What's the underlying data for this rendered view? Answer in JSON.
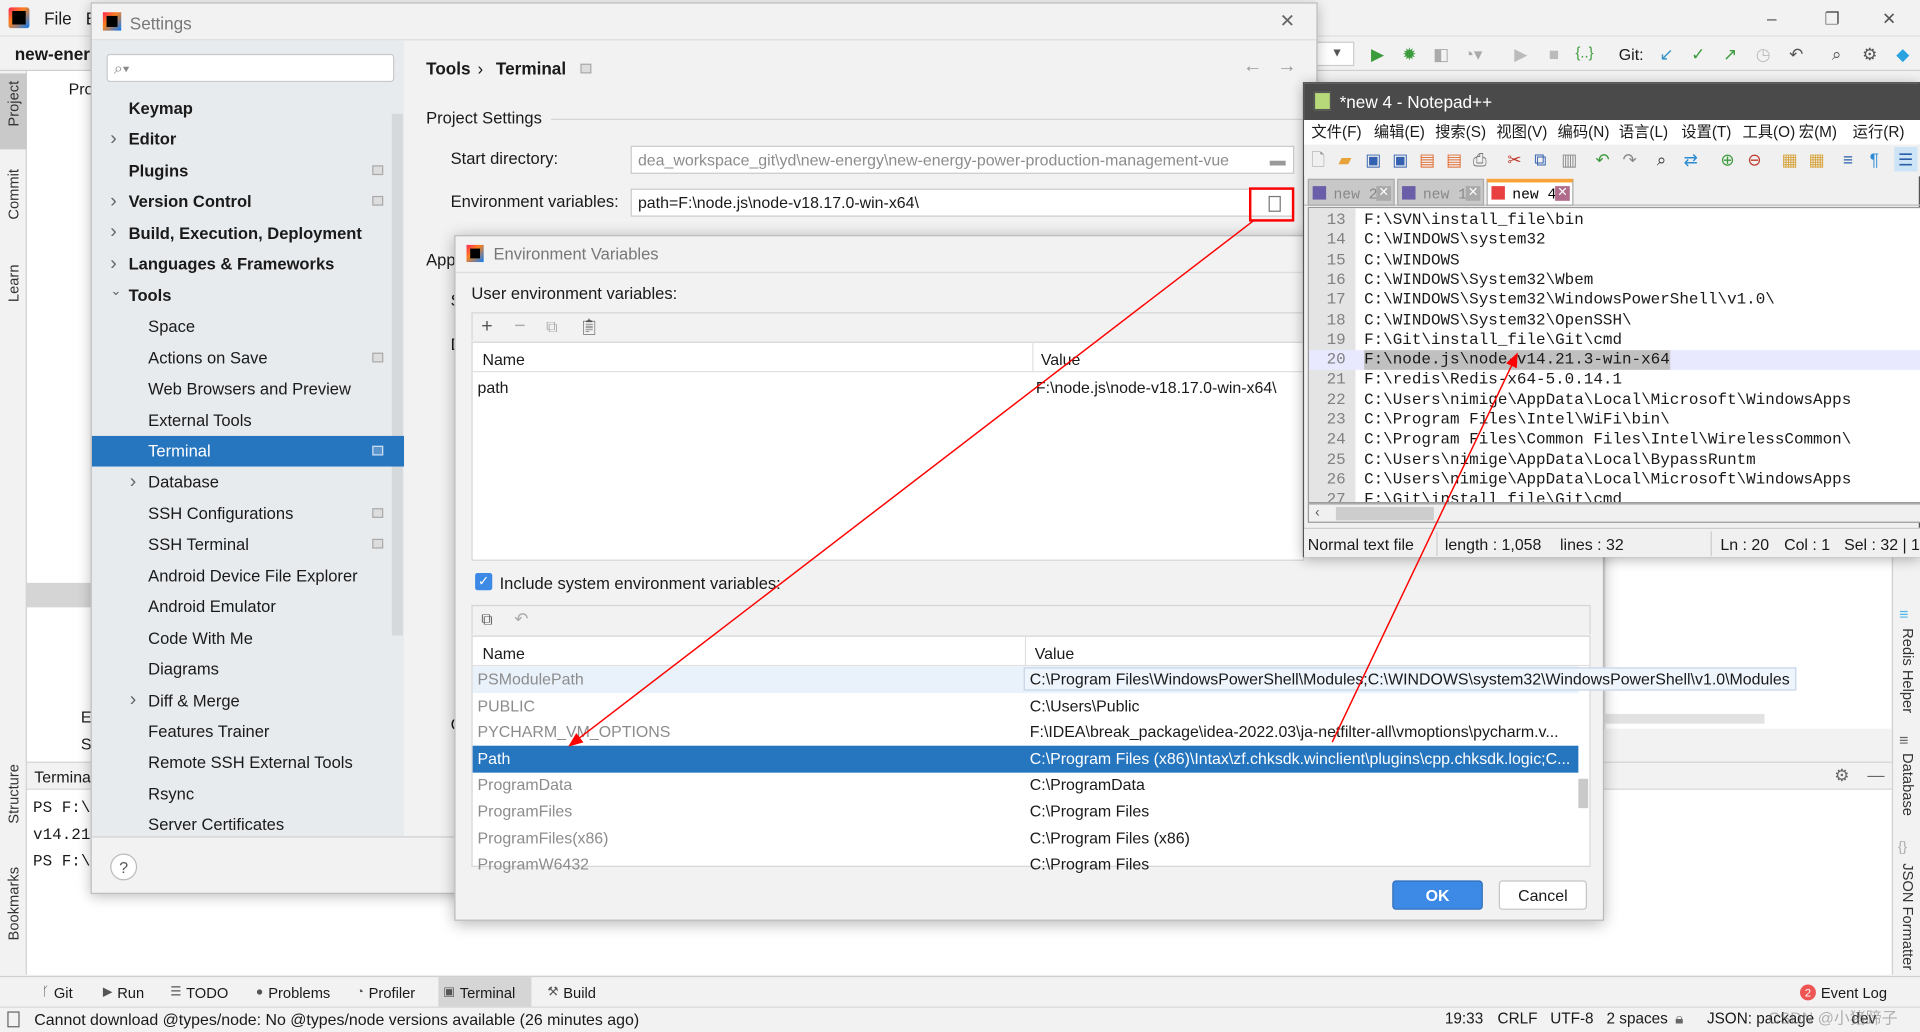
{
  "ide": {
    "menu": {
      "file": "File",
      "edit_partial": "E"
    },
    "project_name": "new-energ",
    "toolbar": {
      "git_label": "Git:"
    },
    "window_controls": {
      "minimize": "–",
      "restore": "❐",
      "close": "✕"
    },
    "left_strip": [
      "Project",
      "Commit",
      "Learn",
      "Structure",
      "Bookmarks"
    ],
    "right_strip": [
      "Redis Helper",
      "Database",
      "JSON Formatter"
    ],
    "project_tree": {
      "partial_header": "Pro",
      "items_partial": [
        "E",
        "S"
      ]
    },
    "terminal": {
      "header": "Termina",
      "lines": [
        "PS F:\\",
        "v14.21",
        "PS F:\\"
      ]
    },
    "tool_windows": [
      {
        "label": "Git",
        "icon": "git-branch-icon"
      },
      {
        "label": "Run",
        "icon": "play-icon"
      },
      {
        "label": "TODO",
        "icon": "list-icon"
      },
      {
        "label": "Problems",
        "icon": "warning-icon"
      },
      {
        "label": "Profiler",
        "icon": "profiler-icon"
      },
      {
        "label": "Terminal",
        "icon": "terminal-icon",
        "active": true
      },
      {
        "label": "Build",
        "icon": "hammer-icon"
      }
    ],
    "event_log": {
      "label": "Event Log",
      "count": "2"
    },
    "status_bar": {
      "message": "Cannot download @types/node: No @types/node versions available (26 minutes ago)",
      "time": "19:33",
      "line_sep": "CRLF",
      "encoding": "UTF-8",
      "indent": "2 spaces",
      "schema": "JSON: package",
      "branch": "dev"
    },
    "watermark": "CSDN @小猪蹄子"
  },
  "settings": {
    "title": "Settings",
    "search_placeholder": "",
    "breadcrumb": {
      "parent": "Tools",
      "separator": "›",
      "current": "Terminal"
    },
    "nav": [
      {
        "label": "Keymap",
        "level": 0,
        "bold": true
      },
      {
        "label": "Editor",
        "level": 0,
        "bold": true,
        "arrow": "right"
      },
      {
        "label": "Plugins",
        "level": 0,
        "bold": true,
        "mark": true
      },
      {
        "label": "Version Control",
        "level": 0,
        "bold": true,
        "arrow": "right",
        "mark": true
      },
      {
        "label": "Build, Execution, Deployment",
        "level": 0,
        "bold": true,
        "arrow": "right"
      },
      {
        "label": "Languages & Frameworks",
        "level": 0,
        "bold": true,
        "arrow": "right"
      },
      {
        "label": "Tools",
        "level": 0,
        "bold": true,
        "arrow": "down"
      },
      {
        "label": "Space",
        "level": 1
      },
      {
        "label": "Actions on Save",
        "level": 1,
        "mark": true
      },
      {
        "label": "Web Browsers and Preview",
        "level": 1
      },
      {
        "label": "External Tools",
        "level": 1
      },
      {
        "label": "Terminal",
        "level": 1,
        "selected": true,
        "mark": true
      },
      {
        "label": "Database",
        "level": 1,
        "arrow": "right"
      },
      {
        "label": "SSH Configurations",
        "level": 1,
        "mark": true
      },
      {
        "label": "SSH Terminal",
        "level": 1,
        "mark": true
      },
      {
        "label": "Android Device File Explorer",
        "level": 1
      },
      {
        "label": "Android Emulator",
        "level": 1
      },
      {
        "label": "Code With Me",
        "level": 1
      },
      {
        "label": "Diagrams",
        "level": 1
      },
      {
        "label": "Diff & Merge",
        "level": 1,
        "arrow": "right"
      },
      {
        "label": "Features Trainer",
        "level": 1
      },
      {
        "label": "Remote SSH External Tools",
        "level": 1
      },
      {
        "label": "Rsync",
        "level": 1
      },
      {
        "label": "Server Certificates",
        "level": 1
      }
    ],
    "project_settings_label": "Project Settings",
    "start_directory": {
      "label": "Start directory:",
      "value": "dea_workspace_git\\yd\\new-energy\\new-energy-power-production-management-vue"
    },
    "env_vars": {
      "label": "Environment variables:",
      "value": "path=F:\\node.js\\node-v18.17.0-win-x64\\"
    },
    "partial_labels": [
      "App",
      "S",
      "D",
      "C"
    ],
    "help": "?"
  },
  "env_dialog": {
    "title": "Environment Variables",
    "user_label": "User environment variables:",
    "columns": {
      "name": "Name",
      "value": "Value"
    },
    "user_rows": [
      {
        "name": "path",
        "value": "F:\\node.js\\node-v18.17.0-win-x64\\"
      }
    ],
    "include_system": {
      "label": "Include system environment variables:",
      "checked": true
    },
    "system_rows": [
      {
        "name": "PSModulePath",
        "value": "C:\\Program Files\\WindowsPowerShell\\Modules;C:\\WINDOWS\\system32\\WindowsPowerShell\\v1.0\\Modules",
        "hover": true
      },
      {
        "name": "PUBLIC",
        "value": "C:\\Users\\Public"
      },
      {
        "name": "PYCHARM_VM_OPTIONS",
        "value": "F:\\IDEA\\break_package\\idea-2022.03\\ja-netfilter-all\\vmoptions\\pycharm.v..."
      },
      {
        "name": "Path",
        "value": "C:\\Program Files (x86)\\Intax\\zf.chksdk.winclient\\plugins\\cpp.chksdk.logic;C...",
        "selected": true
      },
      {
        "name": "ProgramData",
        "value": "C:\\ProgramData"
      },
      {
        "name": "ProgramFiles",
        "value": "C:\\Program Files"
      },
      {
        "name": "ProgramFiles(x86)",
        "value": "C:\\Program Files (x86)"
      },
      {
        "name": "ProgramW6432",
        "value": "C:\\Program Files"
      }
    ],
    "ok": "OK",
    "cancel": "Cancel"
  },
  "notepad": {
    "title": "*new 4 - Notepad++",
    "menu": [
      "文件(F)",
      "编辑(E)",
      "搜索(S)",
      "视图(V)",
      "编码(N)",
      "语言(L)",
      "设置(T)",
      "工具(O)",
      "宏(M)",
      "运行(R)"
    ],
    "tabs": [
      {
        "label": "new 2"
      },
      {
        "label": "new 1"
      },
      {
        "label": "new 4",
        "active": true
      }
    ],
    "lines": [
      {
        "n": "13",
        "text": "F:\\SVN\\install_file\\bin"
      },
      {
        "n": "14",
        "text": "C:\\WINDOWS\\system32"
      },
      {
        "n": "15",
        "text": "C:\\WINDOWS"
      },
      {
        "n": "16",
        "text": "C:\\WINDOWS\\System32\\Wbem"
      },
      {
        "n": "17",
        "text": "C:\\WINDOWS\\System32\\WindowsPowerShell\\v1.0\\"
      },
      {
        "n": "18",
        "text": "C:\\WINDOWS\\System32\\OpenSSH\\"
      },
      {
        "n": "19",
        "text": "F:\\Git\\install_file\\Git\\cmd"
      },
      {
        "n": "20",
        "text": "F:\\node.js\\node-v14.21.3-win-x64",
        "selected": true
      },
      {
        "n": "21",
        "text": "F:\\redis\\Redis-x64-5.0.14.1"
      },
      {
        "n": "22",
        "text": "C:\\Users\\nimige\\AppData\\Local\\Microsoft\\WindowsApps"
      },
      {
        "n": "23",
        "text": "C:\\Program Files\\Intel\\WiFi\\bin\\"
      },
      {
        "n": "24",
        "text": "C:\\Program Files\\Common Files\\Intel\\WirelessCommon\\"
      },
      {
        "n": "25",
        "text": "C:\\Users\\nimige\\AppData\\Local\\BypassRuntm"
      },
      {
        "n": "26",
        "text": "C:\\Users\\nimige\\AppData\\Local\\Microsoft\\WindowsApps"
      },
      {
        "n": "27",
        "text": "F:\\Git\\install_file\\Git\\cmd"
      }
    ],
    "status": {
      "type": "Normal text file",
      "length": "length : 1,058",
      "lines": "lines : 32",
      "ln": "Ln : 20",
      "col": "Col : 1",
      "sel": "Sel : 32 | 1"
    }
  },
  "colors": {
    "selection": "#2675bf",
    "annotation": "#ff0000",
    "notepad_title": "#4a4a4a",
    "tab_active": "#f8a33a"
  }
}
